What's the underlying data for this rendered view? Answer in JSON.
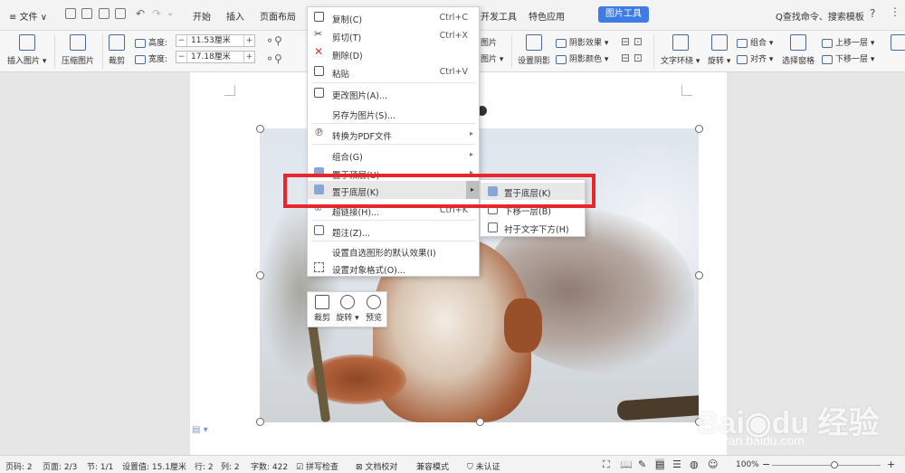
{
  "menubar": {
    "file": "≡ 文件 ∨",
    "tabs": [
      "开始",
      "插入",
      "页面布局"
    ],
    "tabs_right": [
      "开发工具",
      "特色应用"
    ],
    "active_tab": "图片工具",
    "search": "Q查找命令、搜索模板",
    "help": "?",
    "more": "⋮"
  },
  "ribbon": {
    "insert_pic": "插入图片 ▾",
    "compress": "压缩图片",
    "crop": "裁剪",
    "height_label": "高度:",
    "height_value": "11.53厘米",
    "width_label": "宽度:",
    "width_value": "17.18厘米",
    "pic_top": "图片",
    "pic_bottom": "图片 ▾",
    "set_shadow": "设置阴影",
    "shadow_effect": "阴影效果 ▾",
    "shadow_color": "阴影颜色 ▾",
    "text_wrap": "文字环绕 ▾",
    "rotate": "旋转 ▾",
    "group": "组合 ▾",
    "align": "对齐 ▾",
    "select_pane": "选择窗格",
    "bring_forward": "上移一层 ▾",
    "send_backward": "下移一层 ▾"
  },
  "context_menu": {
    "items": [
      {
        "label": "复制(C)",
        "shortcut": "Ctrl+C",
        "icon": "copy-icon"
      },
      {
        "label": "剪切(T)",
        "shortcut": "Ctrl+X",
        "icon": "cut-icon"
      },
      {
        "label": "删除(D)",
        "shortcut": "",
        "icon": "delete-icon"
      },
      {
        "label": "粘贴",
        "shortcut": "Ctrl+V",
        "icon": "paste-icon"
      },
      {
        "label": "更改图片(A)...",
        "shortcut": "",
        "icon": "change-picture-icon"
      },
      {
        "label": "另存为图片(S)...",
        "shortcut": "",
        "icon": ""
      },
      {
        "label": "转换为PDF文件",
        "shortcut": "",
        "icon": "pdf-icon",
        "submenu": true
      },
      {
        "label": "组合(G)",
        "shortcut": "",
        "icon": "",
        "submenu": true
      },
      {
        "label": "置于顶层(U)",
        "shortcut": "",
        "icon": "bring-to-front-icon",
        "submenu": true
      },
      {
        "label": "置于底层(K)",
        "shortcut": "",
        "icon": "send-to-back-icon",
        "submenu": true
      },
      {
        "label": "超链接(H)...",
        "shortcut": "Ctrl+K",
        "icon": "hyperlink-icon"
      },
      {
        "label": "题注(Z)...",
        "shortcut": "",
        "icon": "caption-icon"
      },
      {
        "label": "设置自选图形的默认效果(I)",
        "shortcut": "",
        "icon": ""
      },
      {
        "label": "设置对象格式(O)...",
        "shortcut": "",
        "icon": "format-object-icon"
      }
    ]
  },
  "submenu": {
    "items": [
      "置于底层(K)",
      "下移一层(B)",
      "衬于文字下方(H)"
    ]
  },
  "mini_toolbar": {
    "crop": "裁剪",
    "rotate": "旋转 ▾",
    "preview": "预览"
  },
  "status": {
    "page_num": "页码: 2",
    "pages": "页面: 2/3",
    "section": "节: 1/1",
    "position": "设置值: 15.1厘米",
    "row": "行: 2",
    "col": "列: 2",
    "words": "字数: 422",
    "spell": "拼写检查",
    "proof": "文档校对",
    "compat": "兼容模式",
    "auth": "未认证",
    "zoom": "100%",
    "zoom_minus": "−",
    "zoom_plus": "+",
    "zoom_fraction": 0.55
  },
  "watermark": {
    "brand": "Bai◉du 经验",
    "url": "jingyan.baidu.com"
  },
  "colors": {
    "accent": "#3f7be6",
    "highlight": "#e8262b"
  }
}
